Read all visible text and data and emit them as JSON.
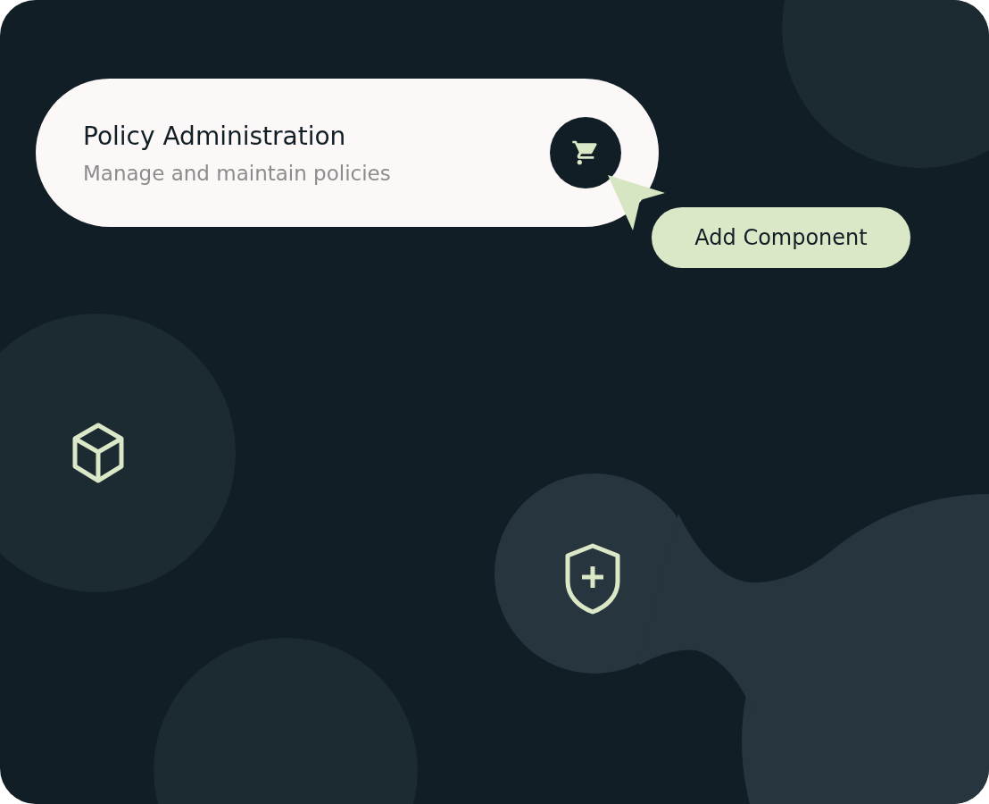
{
  "card": {
    "title": "Policy Administration",
    "subtitle": "Manage and maintain policies"
  },
  "tooltip": {
    "label": "Add Component"
  }
}
